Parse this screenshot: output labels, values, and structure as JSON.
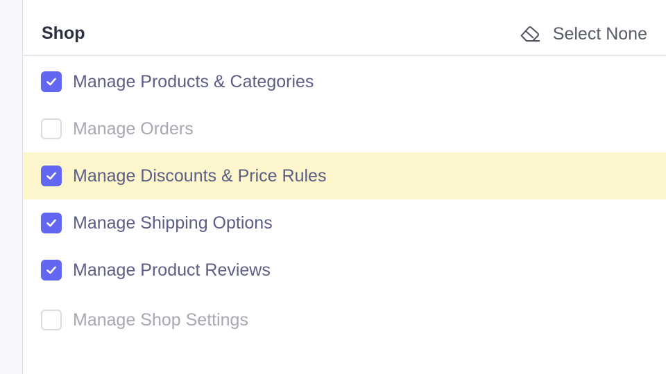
{
  "section": {
    "title": "Shop",
    "select_none_label": "Select None",
    "select_none_icon": "eraser-icon"
  },
  "colors": {
    "accent": "#6366f1",
    "highlight_row": "#fdf5cb"
  },
  "permissions": [
    {
      "label": "Manage Products & Categories",
      "checked": true,
      "highlighted": false
    },
    {
      "label": "Manage Orders",
      "checked": false,
      "highlighted": false
    },
    {
      "label": "Manage Discounts & Price Rules",
      "checked": true,
      "highlighted": true
    },
    {
      "label": "Manage Shipping Options",
      "checked": true,
      "highlighted": false
    },
    {
      "label": "Manage Product Reviews",
      "checked": true,
      "highlighted": false
    },
    {
      "label": "Manage Shop Settings",
      "checked": false,
      "highlighted": false
    }
  ]
}
